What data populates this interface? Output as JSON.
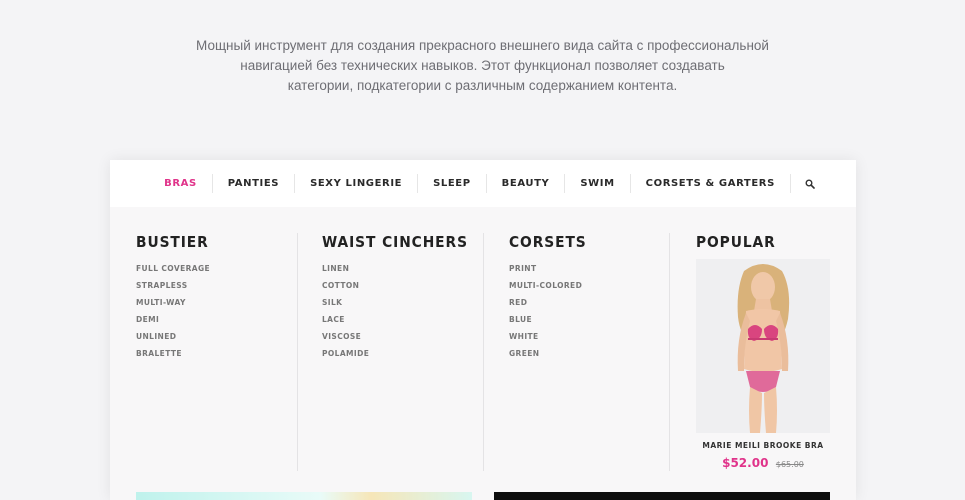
{
  "intro": {
    "line1": "Мощный инструмент для создания прекрасного внешнего вида сайта с профессиональной",
    "line2": "навигацией без технических навыков. Этот функционал позволяет создавать",
    "line3": "категории, подкатегории с различным содержанием контента."
  },
  "nav": {
    "items": [
      {
        "label": "BRAS",
        "active": true
      },
      {
        "label": "PANTIES"
      },
      {
        "label": "SEXY LINGERIE"
      },
      {
        "label": "SLEEP"
      },
      {
        "label": "BEAUTY"
      },
      {
        "label": "SWIM"
      },
      {
        "label": "CORSETS & GARTERS"
      }
    ],
    "search_icon": "search-icon",
    "accent_color": "#e0338a"
  },
  "columns": [
    {
      "title": "BUSTIER",
      "items": [
        "FULL COVERAGE",
        "STRAPLESS",
        "MULTI-WAY",
        "DEMI",
        "UNLINED",
        "BRALETTE"
      ]
    },
    {
      "title": "WAIST CINCHERS",
      "items": [
        "LINEN",
        "COTTON",
        "SILK",
        "LACE",
        "VISCOSE",
        "POLAMIDE"
      ]
    },
    {
      "title": "CORSETS",
      "items": [
        "PRINT",
        "MULTI-COLORED",
        "RED",
        "BLUE",
        "WHITE",
        "GREEN"
      ]
    }
  ],
  "popular": {
    "title": "POPULAR",
    "product_name": "MARIE MEILI BROOKE BRA",
    "price": "$52.00",
    "old_price": "$65.00"
  }
}
